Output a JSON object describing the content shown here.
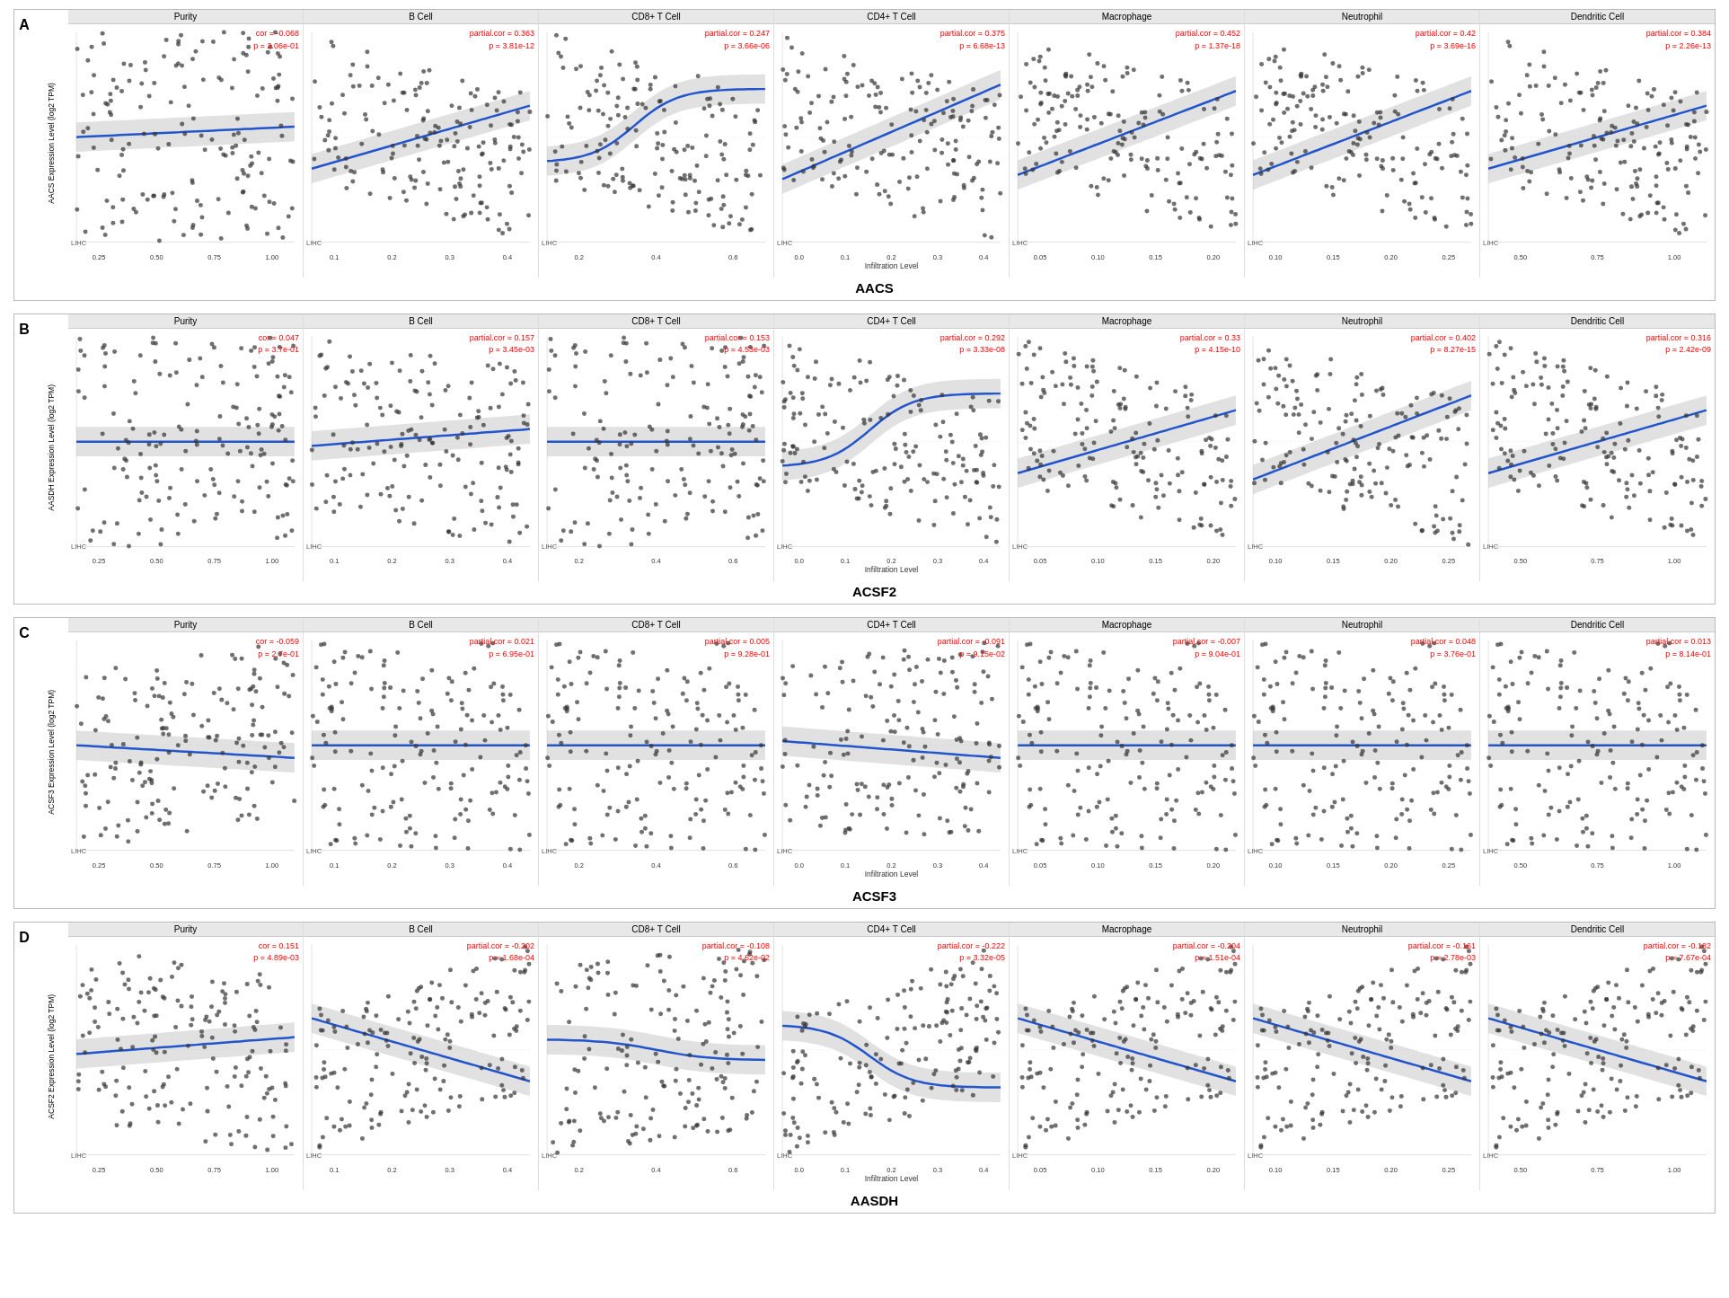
{
  "rows": [
    {
      "id": "A",
      "title": "AACS",
      "ylabel": "AACS Expression Level (log2 TPM)",
      "plots": [
        {
          "header": "Purity",
          "stat1": "cor = -0.068",
          "stat2": "p = 2.06e-01",
          "xticks": [
            "0.25",
            "0.50",
            "0.75",
            "1.00"
          ],
          "curve_type": "flat_slight_up",
          "dots_density": "medium"
        },
        {
          "header": "B Cell",
          "stat1": "partial.cor = 0.363",
          "stat2": "p = 3.81e-12",
          "xticks": [
            "0.1",
            "0.2",
            "0.3",
            "0.4"
          ],
          "curve_type": "rising",
          "dots_density": "medium"
        },
        {
          "header": "CD8+ T Cell",
          "stat1": "partial.cor = 0.247",
          "stat2": "p = 3.66e-06",
          "xticks": [
            "0.2",
            "0.4",
            "0.6"
          ],
          "curve_type": "rising_s",
          "dots_density": "medium"
        },
        {
          "header": "CD4+ T Cell",
          "stat1": "partial.cor = 0.375",
          "stat2": "p = 6.68e-13",
          "xticks": [
            "0.0",
            "0.1",
            "0.2",
            "0.3",
            "0.4"
          ],
          "curve_type": "rising_steep",
          "dots_density": "medium"
        },
        {
          "header": "Macrophage",
          "stat1": "partial.cor = 0.452",
          "stat2": "p = 1.37e-18",
          "xticks": [
            "0.05",
            "0.10",
            "0.15",
            "0.20"
          ],
          "curve_type": "rising_strong",
          "dots_density": "medium"
        },
        {
          "header": "Neutrophil",
          "stat1": "partial.cor = 0.42",
          "stat2": "p = 3.69e-16",
          "xticks": [
            "0.10",
            "0.15",
            "0.20",
            "0.25"
          ],
          "curve_type": "rising_strong",
          "dots_density": "medium"
        },
        {
          "header": "Dendritic Cell",
          "stat1": "partial.cor = 0.384",
          "stat2": "p = 2.26e-13",
          "xticks": [
            "0.50",
            "0.75",
            "1.00"
          ],
          "curve_type": "rising",
          "dots_density": "medium"
        }
      ]
    },
    {
      "id": "B",
      "title": "ACSF2",
      "ylabel": "AASDH Expression Level (log2 TPM)",
      "plots": [
        {
          "header": "Purity",
          "stat1": "cor = 0.047",
          "stat2": "p = 3.7e-01",
          "xticks": [
            "0.25",
            "0.50",
            "0.75",
            "1.00"
          ],
          "curve_type": "flat",
          "dots_density": "medium"
        },
        {
          "header": "B Cell",
          "stat1": "partial.cor = 0.157",
          "stat2": "p = 3.45e-03",
          "xticks": [
            "0.1",
            "0.2",
            "0.3",
            "0.4"
          ],
          "curve_type": "slight_rise",
          "dots_density": "medium"
        },
        {
          "header": "CD8+ T Cell",
          "stat1": "partial.cor = 0.153",
          "stat2": "p = 4.53e-03",
          "xticks": [
            "0.2",
            "0.4",
            "0.6"
          ],
          "curve_type": "flat",
          "dots_density": "medium"
        },
        {
          "header": "CD4+ T Cell",
          "stat1": "partial.cor = 0.292",
          "stat2": "p = 3.33e-08",
          "xticks": [
            "0.0",
            "0.1",
            "0.2",
            "0.3",
            "0.4"
          ],
          "curve_type": "rising_s",
          "dots_density": "medium"
        },
        {
          "header": "Macrophage",
          "stat1": "partial.cor = 0.33",
          "stat2": "p = 4.15e-10",
          "xticks": [
            "0.05",
            "0.10",
            "0.15",
            "0.20"
          ],
          "curve_type": "rising",
          "dots_density": "medium"
        },
        {
          "header": "Neutrophil",
          "stat1": "partial.cor = 0.402",
          "stat2": "p = 8.27e-15",
          "xticks": [
            "0.10",
            "0.15",
            "0.20",
            "0.25"
          ],
          "curve_type": "rising_strong",
          "dots_density": "medium"
        },
        {
          "header": "Dendritic Cell",
          "stat1": "partial.cor = 0.316",
          "stat2": "p = 2.42e-09",
          "xticks": [
            "0.50",
            "0.75",
            "1.00"
          ],
          "curve_type": "rising",
          "dots_density": "medium"
        }
      ]
    },
    {
      "id": "C",
      "title": "ACSF3",
      "ylabel": "ACSF3 Expression Level (log2 TPM)",
      "plots": [
        {
          "header": "Purity",
          "stat1": "cor = -0.059",
          "stat2": "p = 2.7e-01",
          "xticks": [
            "0.25",
            "0.50",
            "0.75",
            "1.00"
          ],
          "curve_type": "flat_down",
          "dots_density": "medium"
        },
        {
          "header": "B Cell",
          "stat1": "partial.cor = 0.021",
          "stat2": "p = 6.95e-01",
          "xticks": [
            "0.1",
            "0.2",
            "0.3",
            "0.4"
          ],
          "curve_type": "flat",
          "dots_density": "medium"
        },
        {
          "header": "CD8+ T Cell",
          "stat1": "partial.cor = 0.005",
          "stat2": "p = 9.28e-01",
          "xticks": [
            "0.2",
            "0.4",
            "0.6"
          ],
          "curve_type": "flat",
          "dots_density": "medium"
        },
        {
          "header": "CD4+ T Cell",
          "stat1": "partial.cor = -0.091",
          "stat2": "p = 9.15e-02",
          "xticks": [
            "0.0",
            "0.1",
            "0.2",
            "0.3",
            "0.4"
          ],
          "curve_type": "slight_down",
          "dots_density": "medium"
        },
        {
          "header": "Macrophage",
          "stat1": "partial.cor = -0.007",
          "stat2": "p = 9.04e-01",
          "xticks": [
            "0.05",
            "0.10",
            "0.15",
            "0.20"
          ],
          "curve_type": "flat",
          "dots_density": "medium"
        },
        {
          "header": "Neutrophil",
          "stat1": "partial.cor = 0.048",
          "stat2": "p = 3.76e-01",
          "xticks": [
            "0.10",
            "0.15",
            "0.20",
            "0.25"
          ],
          "curve_type": "flat",
          "dots_density": "medium"
        },
        {
          "header": "Dendritic Cell",
          "stat1": "partial.cor = 0.013",
          "stat2": "p = 8.14e-01",
          "xticks": [
            "0.50",
            "0.75",
            "1.00"
          ],
          "curve_type": "flat",
          "dots_density": "medium"
        }
      ]
    },
    {
      "id": "D",
      "title": "AASDH",
      "ylabel": "ACSF2 Expression Level (log2 TPM)",
      "plots": [
        {
          "header": "Purity",
          "stat1": "cor = 0.151",
          "stat2": "p = 4.89e-03",
          "xticks": [
            "0.25",
            "0.50",
            "0.75",
            "1.00"
          ],
          "curve_type": "slight_rise",
          "dots_density": "medium"
        },
        {
          "header": "B Cell",
          "stat1": "partial.cor = -0.202",
          "stat2": "p = 1.68e-04",
          "xticks": [
            "0.1",
            "0.2",
            "0.3",
            "0.4"
          ],
          "curve_type": "falling",
          "dots_density": "medium"
        },
        {
          "header": "CD8+ T Cell",
          "stat1": "partial.cor = -0.108",
          "stat2": "p = 4.62e-02",
          "xticks": [
            "0.2",
            "0.4",
            "0.6"
          ],
          "curve_type": "slight_down_s",
          "dots_density": "medium"
        },
        {
          "header": "CD4+ T Cell",
          "stat1": "partial.cor = -0.222",
          "stat2": "p = 3.32e-05",
          "xticks": [
            "0.0",
            "0.1",
            "0.2",
            "0.3",
            "0.4"
          ],
          "curve_type": "falling_s",
          "dots_density": "medium"
        },
        {
          "header": "Macrophage",
          "stat1": "partial.cor = -0.204",
          "stat2": "p = 1.51e-04",
          "xticks": [
            "0.05",
            "0.10",
            "0.15",
            "0.20"
          ],
          "curve_type": "falling",
          "dots_density": "medium"
        },
        {
          "header": "Neutrophil",
          "stat1": "partial.cor = -0.161",
          "stat2": "p = 2.78e-03",
          "xticks": [
            "0.10",
            "0.15",
            "0.20",
            "0.25"
          ],
          "curve_type": "falling",
          "dots_density": "medium"
        },
        {
          "header": "Dendritic Cell",
          "stat1": "partial.cor = -0.182",
          "stat2": "p = 7.67e-04",
          "xticks": [
            "0.50",
            "0.75",
            "1.00"
          ],
          "curve_type": "falling",
          "dots_density": "medium"
        }
      ]
    }
  ],
  "xlabel": "Infiltration Level"
}
